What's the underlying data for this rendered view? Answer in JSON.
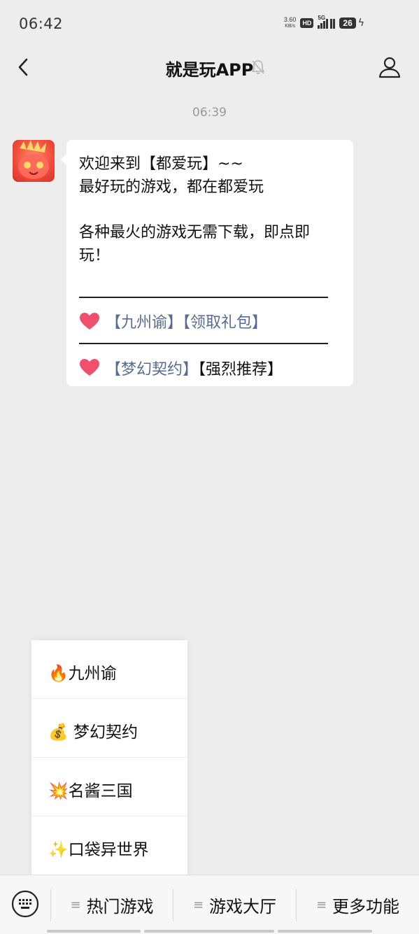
{
  "status_bar": {
    "time": "06:42",
    "speed_value": "3.60",
    "speed_unit": "KB/s",
    "hd_label": "HD",
    "network_label": "5G",
    "battery": "26"
  },
  "header": {
    "title": "就是玩APP"
  },
  "chat": {
    "timestamp": "06:39",
    "message": {
      "lines": [
        "欢迎来到【都爱玩】~~",
        "最好玩的游戏，都在都爱玩",
        "各种最火的游戏无需下载，即点即",
        "玩！"
      ],
      "row1_link_a": "【九州谕】",
      "row1_link_b": "【领取礼包】",
      "row2_link_a": "【梦幻契约】",
      "row2_text_b": "【强烈推荐】"
    }
  },
  "popup_menu": {
    "items": [
      "🔥九州谕",
      "💰 梦幻契约",
      "💥名酱三国",
      "✨口袋异世界"
    ]
  },
  "bottom_bar": {
    "menus": [
      "热门游戏",
      "游戏大厅",
      "更多功能"
    ]
  },
  "colors": {
    "link": "#576b95",
    "background": "#ededed",
    "heart": "#f0506e"
  }
}
